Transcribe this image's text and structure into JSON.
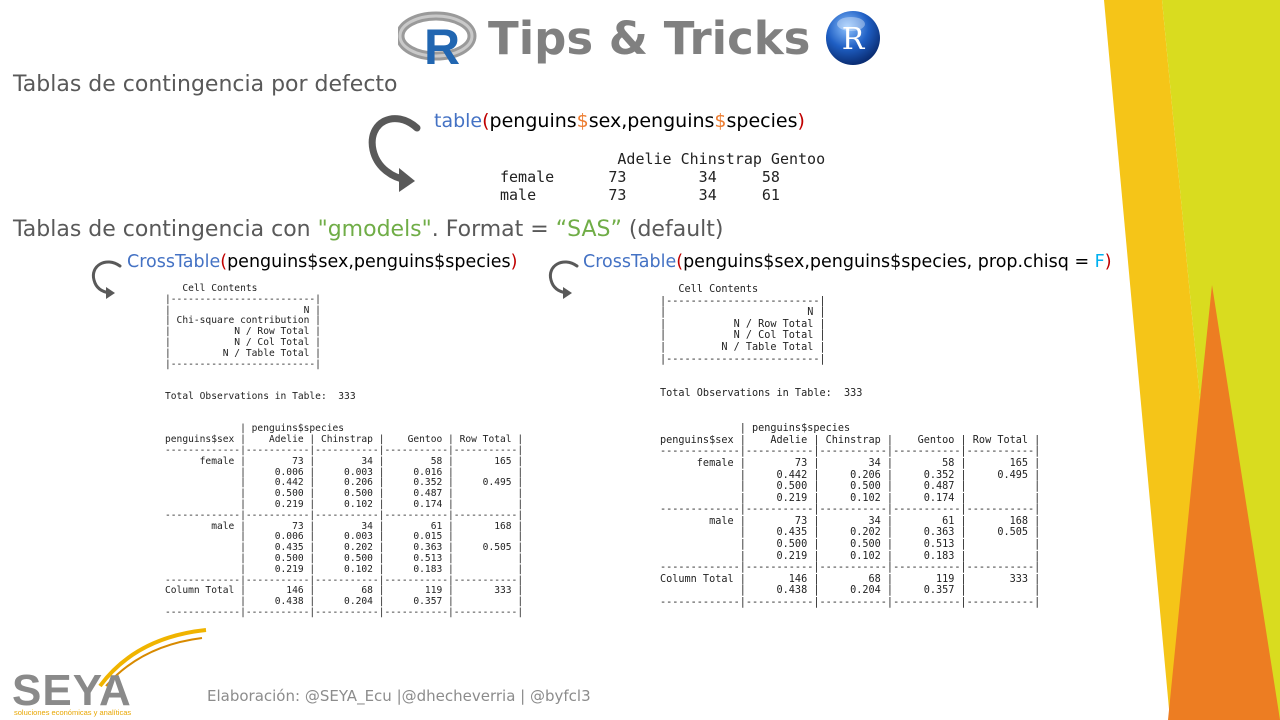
{
  "header": {
    "title": "Tips & Tricks",
    "logo_left_letter": "R",
    "logo_right_letter": "R"
  },
  "section1": {
    "heading": "Tablas de contingencia por defecto",
    "code": {
      "fn": "table",
      "open": "(",
      "a1": "penguins",
      "dollar1": "$",
      "a2": "sex,penguins",
      "dollar2": "$",
      "a3": "species",
      "close": ")"
    },
    "output": "             Adelie Chinstrap Gentoo\nfemale      73        34     58\nmale        73        34     61"
  },
  "section2": {
    "heading_prefix": "Tablas de contingencia con ",
    "heading_pkg": "\"gmodels\"",
    "heading_mid": ". Format = ",
    "heading_fmt": "“SAS”",
    "heading_suffix": " (default)",
    "left_code": {
      "fn": "CrossTable",
      "open": "(",
      "args": "penguins$sex,penguins$species",
      "close": ")"
    },
    "right_code": {
      "fn": "CrossTable",
      "open": "(",
      "args": "penguins$sex,penguins$species,  prop.chisq = ",
      "flag": "F",
      "close": ")"
    },
    "left_output": "   Cell Contents\n|-------------------------|\n|                       N |\n| Chi-square contribution |\n|           N / Row Total |\n|           N / Col Total |\n|         N / Table Total |\n|-------------------------|\n\n\nTotal Observations in Table:  333\n\n\n             | penguins$species\npenguins$sex |    Adelie | Chinstrap |    Gentoo | Row Total |\n-------------|-----------|-----------|-----------|-----------|\n      female |        73 |        34 |        58 |       165 |\n             |     0.006 |     0.003 |     0.016 |           |\n             |     0.442 |     0.206 |     0.352 |     0.495 |\n             |     0.500 |     0.500 |     0.487 |           |\n             |     0.219 |     0.102 |     0.174 |           |\n-------------|-----------|-----------|-----------|-----------|\n        male |        73 |        34 |        61 |       168 |\n             |     0.006 |     0.003 |     0.015 |           |\n             |     0.435 |     0.202 |     0.363 |     0.505 |\n             |     0.500 |     0.500 |     0.513 |           |\n             |     0.219 |     0.102 |     0.183 |           |\n-------------|-----------|-----------|-----------|-----------|\nColumn Total |       146 |        68 |       119 |       333 |\n             |     0.438 |     0.204 |     0.357 |           |\n-------------|-----------|-----------|-----------|-----------|",
    "right_output": "   Cell Contents\n|-------------------------|\n|                       N |\n|           N / Row Total |\n|           N / Col Total |\n|         N / Table Total |\n|-------------------------|\n\n\nTotal Observations in Table:  333\n\n\n             | penguins$species\npenguins$sex |    Adelie | Chinstrap |    Gentoo | Row Total |\n-------------|-----------|-----------|-----------|-----------|\n      female |        73 |        34 |        58 |       165 |\n             |     0.442 |     0.206 |     0.352 |     0.495 |\n             |     0.500 |     0.500 |     0.487 |           |\n             |     0.219 |     0.102 |     0.174 |           |\n-------------|-----------|-----------|-----------|-----------|\n        male |        73 |        34 |        61 |       168 |\n             |     0.435 |     0.202 |     0.363 |     0.505 |\n             |     0.500 |     0.500 |     0.513 |           |\n             |     0.219 |     0.102 |     0.183 |           |\n-------------|-----------|-----------|-----------|-----------|\nColumn Total |       146 |        68 |       119 |       333 |\n             |     0.438 |     0.204 |     0.357 |           |\n-------------|-----------|-----------|-----------|-----------|"
  },
  "footer": {
    "credit": "Elaboración: @SEYA_Ecu |@dhecheverria | @byfcl3",
    "logo_name": "SEYA",
    "logo_subtitle": "soluciones económicas y analíticas"
  },
  "colors": {
    "accent_yellow": "#f5c518",
    "accent_lime": "#d9dc1f",
    "accent_orange": "#ed7d22",
    "code_blue": "#4472c4",
    "code_orange": "#ed7d31",
    "code_green": "#70ad47"
  }
}
